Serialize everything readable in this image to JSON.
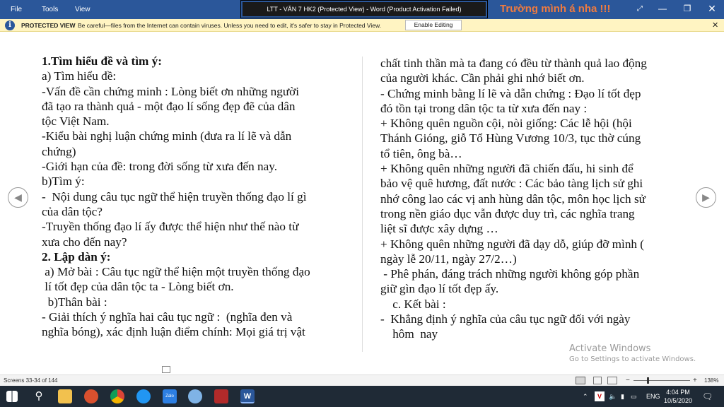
{
  "menu": {
    "file": "File",
    "tools": "Tools",
    "view": "View"
  },
  "window": {
    "title": "LTT - VĂN 7 HK2 (Protected View) - Word (Product Activation Failed)",
    "overlay_text": "Trường mình á nha !!!"
  },
  "protected_view": {
    "label": "PROTECTED VIEW",
    "message": "Be careful—files from the Internet can contain viruses. Unless you need to edit, it's safer to stay in Protected View.",
    "button": "Enable Editing"
  },
  "left_page": [
    {
      "text": "1.Tìm hiểu đề và tìm ý:",
      "bold": true
    },
    {
      "text": "a) Tìm hiểu đề:"
    },
    {
      "text": "-Vấn đề cần chứng minh : Lòng biết ơn những người"
    },
    {
      "text": "đã tạo ra thành quả - một đạo lí sống đẹp đẽ của dân"
    },
    {
      "text": "tộc Việt Nam."
    },
    {
      "text": "-Kiểu bài nghị luận chứng minh (đưa ra lí lẽ và dẫn"
    },
    {
      "text": "chứng)"
    },
    {
      "text": "-Giới hạn của đề: trong đời sống từ xưa đến nay."
    },
    {
      "text": "b)Tìm ý:"
    },
    {
      "text": "-  Nội dung câu tục ngữ thể hiện truyền thống đạo lí gì"
    },
    {
      "text": "của dân tộc?"
    },
    {
      "text": "-Truyền thống đạo lí ấy được thể hiện như thế nào từ"
    },
    {
      "text": "xưa cho đến nay?"
    },
    {
      "text": "2. Lập dàn ý:",
      "bold": true
    },
    {
      "text": " a) Mở bài : Câu tục ngữ thể hiện một truyền thống đạo"
    },
    {
      "text": " lí tốt đẹp của dân tộc ta - Lòng biết ơn."
    },
    {
      "text": "  b)Thân bài :"
    },
    {
      "text": "- Giải thích ý nghĩa hai câu tục ngữ :  (nghĩa đen và"
    },
    {
      "text": "nghĩa bóng), xác định luận điểm chính: Mọi giá trị vật"
    }
  ],
  "right_page": [
    {
      "text": "chất tinh thần mà ta đang có đều từ thành quả lao động"
    },
    {
      "text": "của người khác. Cần phải ghi nhớ biết ơn."
    },
    {
      "text": "- Chứng minh bằng lí lẽ và dẫn chứng : Đạo lí tốt đẹp"
    },
    {
      "text": "đó tồn tại trong dân tộc ta từ xưa đến nay :"
    },
    {
      "text": "+ Không quên nguồn cội, nòi giống: Các lễ hội (hội"
    },
    {
      "text": "Thánh Gióng, giỗ Tổ Hùng Vương 10/3, tục thờ cúng"
    },
    {
      "text": "tổ tiên, ông bà…"
    },
    {
      "text": "+ Không quên những người đã chiến đấu, hi sinh để"
    },
    {
      "text": "bảo vệ quê hương, đất nước : Các bảo tàng lịch sử ghi"
    },
    {
      "text": "nhớ công lao các vị anh hùng dân tộc, môn học lịch sử"
    },
    {
      "text": "trong nền giáo dục vẫn được duy trì, các nghĩa trang"
    },
    {
      "text": "liệt sĩ được xây dựng …"
    },
    {
      "text": "+ Không quên những người đã dạy dỗ, giúp đỡ mình ("
    },
    {
      "text": "ngày lễ 20/11, ngày 27/2…)"
    },
    {
      "text": " - Phê phán, đáng trách những người không góp phần"
    },
    {
      "text": "giữ gìn đạo lí tốt đẹp ấy."
    },
    {
      "text": "    c. Kết bài :"
    },
    {
      "text": "-  Khẳng định ý nghĩa của câu tục ngữ đối với ngày"
    },
    {
      "text": "    hôm  nay"
    }
  ],
  "watermark": {
    "title": "Activate Windows",
    "subtitle": "Go to Settings to activate Windows."
  },
  "status": {
    "screens": "Screens 33-34 of 144",
    "zoom": "138%"
  },
  "tray": {
    "lang": "ENG",
    "time": "4:04 PM",
    "date": "10/5/2020"
  },
  "colors": {
    "word_blue": "#2b579a",
    "overlay_orange": "#f07b3f",
    "pv_yellow": "#fff4c2"
  }
}
